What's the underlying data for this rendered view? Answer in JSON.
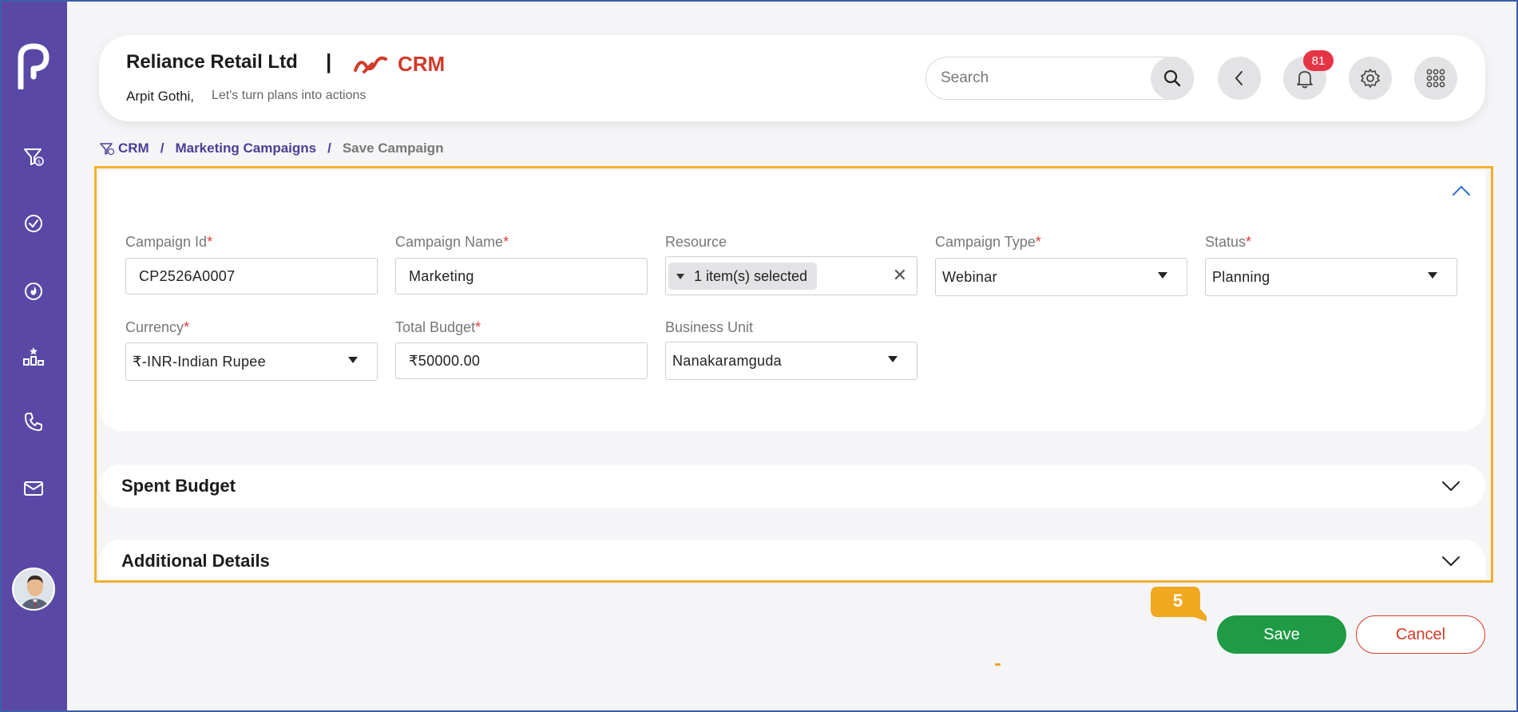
{
  "header": {
    "company": "Reliance Retail Ltd",
    "separator": "|",
    "module": "CRM",
    "user_name": "Arpit Gothi,",
    "tagline": "Let's turn plans into actions",
    "search_placeholder": "Search",
    "notification_count": "81"
  },
  "breadcrumb": {
    "items": [
      "CRM",
      "Marketing Campaigns",
      "Save Campaign"
    ],
    "separator": "/"
  },
  "form": {
    "campaign_id": {
      "label": "Campaign Id",
      "required": "*",
      "value": "CP2526A0007"
    },
    "campaign_name": {
      "label": "Campaign Name",
      "required": "*",
      "value": "Marketing"
    },
    "resource": {
      "label": "Resource",
      "value": "1 item(s) selected",
      "clear": "✕"
    },
    "campaign_type": {
      "label": "Campaign Type",
      "required": "*",
      "value": "Webinar"
    },
    "status": {
      "label": "Status",
      "required": "*",
      "value": "Planning"
    },
    "currency": {
      "label": "Currency",
      "required": "*",
      "value": "₹-INR-Indian Rupee"
    },
    "total_budget": {
      "label": "Total Budget",
      "required": "*",
      "value": "₹50000.00"
    },
    "business_unit": {
      "label": "Business Unit",
      "value": "Nanakaramguda"
    }
  },
  "sections": {
    "spent_budget": "Spent Budget",
    "additional_details": "Additional Details"
  },
  "actions": {
    "save": "Save",
    "cancel": "Cancel",
    "step_number": "5"
  },
  "colors": {
    "sidebar": "#5a48a6",
    "accent_red": "#d23a2a",
    "save_green": "#1f9a45",
    "highlight": "#f0b02d",
    "breadcrumb_link": "#4a3f95"
  }
}
